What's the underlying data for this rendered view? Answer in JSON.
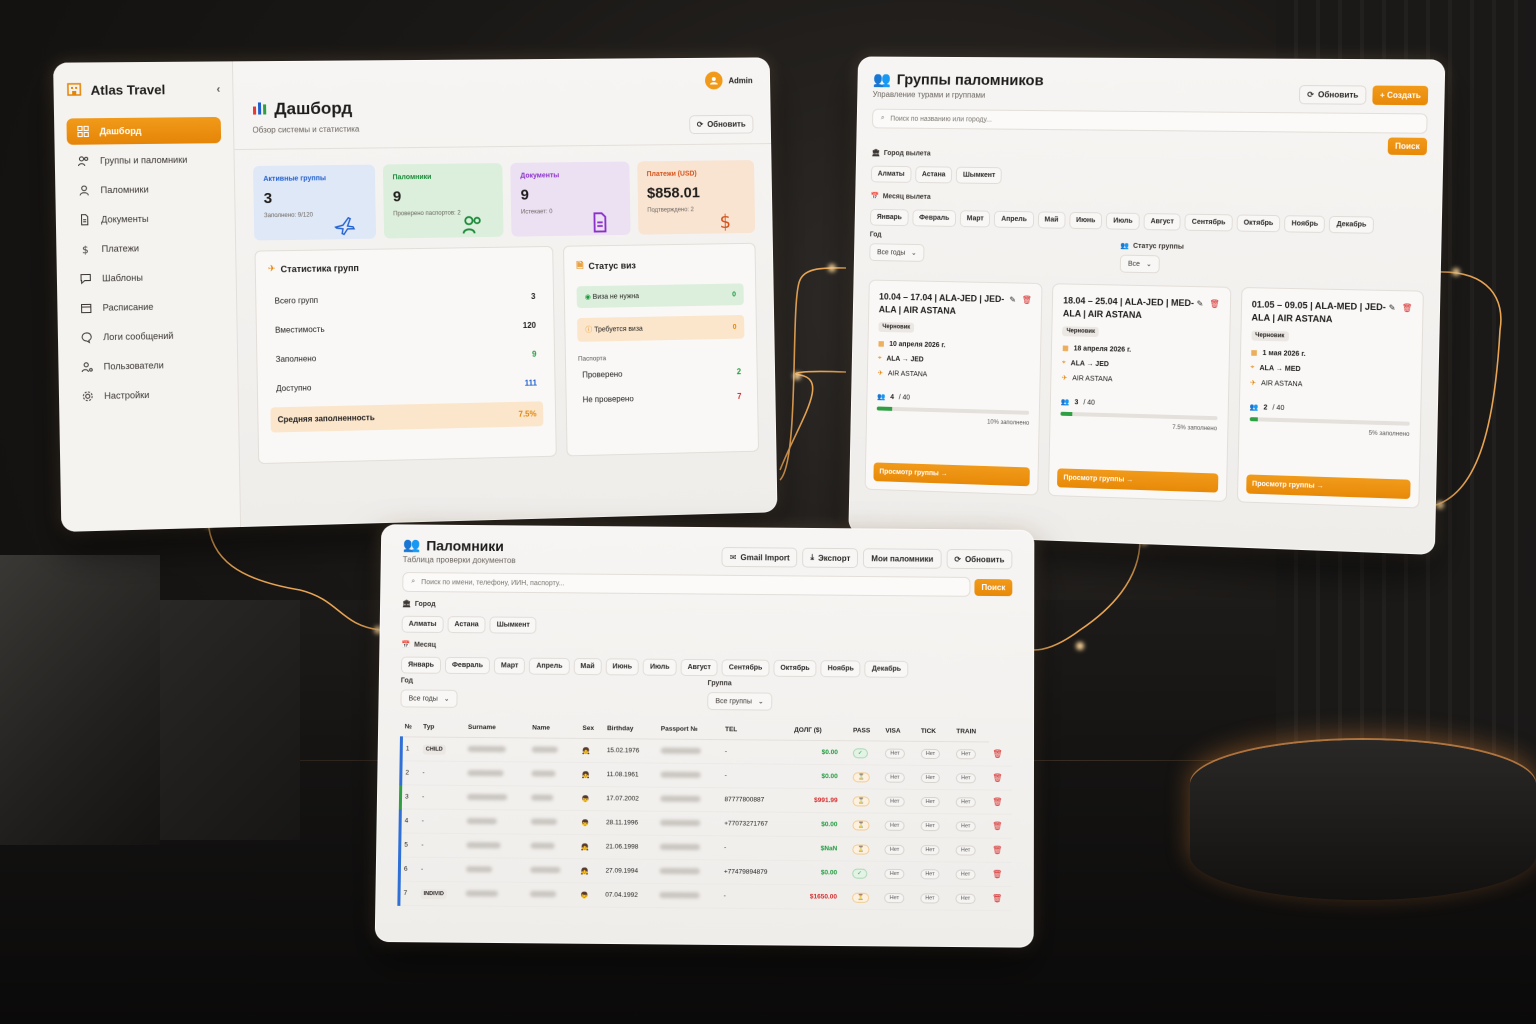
{
  "dashboard": {
    "brand": "Atlas Travel",
    "admin": "Admin",
    "title": "Дашборд",
    "subtitle": "Обзор системы и статистика",
    "refresh": "Обновить",
    "nav": [
      {
        "label": "Дашборд",
        "icon": "grid-icon"
      },
      {
        "label": "Группы и паломники",
        "icon": "users-icon"
      },
      {
        "label": "Паломники",
        "icon": "user-icon"
      },
      {
        "label": "Документы",
        "icon": "document-icon"
      },
      {
        "label": "Платежи",
        "icon": "dollar-icon"
      },
      {
        "label": "Шаблоны",
        "icon": "message-square-icon"
      },
      {
        "label": "Расписание",
        "icon": "calendar-icon"
      },
      {
        "label": "Логи сообщений",
        "icon": "chat-icon"
      },
      {
        "label": "Пользователи",
        "icon": "user-gear-icon"
      },
      {
        "label": "Настройки",
        "icon": "gear-icon"
      }
    ],
    "stats": [
      {
        "title": "Активные группы",
        "value": "3",
        "sub": "Заполнено: 9/120",
        "color": "#1f5fd0",
        "bg": "#dfe8f6",
        "icon": "plane-icon"
      },
      {
        "title": "Паломники",
        "value": "9",
        "sub": "Проверено паспортов: 2",
        "color": "#1b8a3a",
        "bg": "#dcefdc",
        "icon": "users-icon"
      },
      {
        "title": "Документы",
        "value": "9",
        "sub": "Истекает: 0",
        "color": "#8a2fc9",
        "bg": "#ece0f3",
        "icon": "document-icon"
      },
      {
        "title": "Платежи (USD)",
        "value": "$858.01",
        "sub": "Подтверждено: 2",
        "color": "#d4521a",
        "bg": "#f9e4d2",
        "icon": "dollar-icon"
      }
    ],
    "group_stats": {
      "title": "Статистика групп",
      "rows": [
        {
          "label": "Всего групп",
          "value": "3",
          "color": "#1f1d1b"
        },
        {
          "label": "Вместимость",
          "value": "120",
          "color": "#1f1d1b"
        },
        {
          "label": "Заполнено",
          "value": "9",
          "color": "#1b9a3b"
        },
        {
          "label": "Доступно",
          "value": "111",
          "color": "#1f5fd0"
        }
      ],
      "avg_label": "Средняя заполненность",
      "avg_value": "7.5%"
    },
    "visa": {
      "title": "Статус виз",
      "not_needed": "Виза не нужна",
      "not_needed_val": "0",
      "needed": "Требуется виза",
      "needed_val": "0",
      "passports": "Паспорта",
      "checked": "Проверено",
      "checked_val": "2",
      "unchecked": "Не проверено",
      "unchecked_val": "7"
    }
  },
  "groups": {
    "title": "Группы паломников",
    "subtitle": "Управление турами и группами",
    "refresh": "Обновить",
    "create": "+ Создать",
    "search_placeholder": "Поиск по названию или городу...",
    "search_btn": "Поиск",
    "city_label": "Город вылета",
    "cities": [
      "Алматы",
      "Астана",
      "Шымкент"
    ],
    "month_label": "Месяц вылета",
    "months": [
      "Январь",
      "Февраль",
      "Март",
      "Апрель",
      "Май",
      "Июнь",
      "Июль",
      "Август",
      "Сентябрь",
      "Октябрь",
      "Ноябрь",
      "Декабрь"
    ],
    "year_label": "Год",
    "year_value": "Все годы",
    "status_label": "Статус группы",
    "status_value": "Все",
    "cards": [
      {
        "title": "10.04 – 17.04 | ALA-JED | JED-ALA | AIR ASTANA",
        "badge": "Черновик",
        "date": "10 апреля 2026 г.",
        "route": "ALA → JED",
        "airline": "AIR ASTANA",
        "count": "4",
        "cap": "/ 40",
        "fill": 0.1,
        "fill_txt": "10% заполнено",
        "btn": "Просмотр группы →"
      },
      {
        "title": "18.04 – 25.04 | ALA-JED | MED-ALA | AIR ASTANA",
        "badge": "Черновик",
        "date": "18 апреля 2026 г.",
        "route": "ALA → JED",
        "airline": "AIR ASTANA",
        "count": "3",
        "cap": "/ 40",
        "fill": 0.075,
        "fill_txt": "7.5% заполнено",
        "btn": "Просмотр группы →"
      },
      {
        "title": "01.05 – 09.05 | ALA-MED | JED-ALA | AIR ASTANA",
        "badge": "Черновик",
        "date": "1 мая 2026 г.",
        "route": "ALA → MED",
        "airline": "AIR ASTANA",
        "count": "2",
        "cap": "/ 40",
        "fill": 0.05,
        "fill_txt": "5% заполнено",
        "btn": "Просмотр группы →"
      }
    ]
  },
  "pilgrims": {
    "title": "Паломники",
    "subtitle": "Таблица проверки документов",
    "gmail": "Gmail Import",
    "export": "Экспорт",
    "mine": "Мои паломники",
    "refresh": "Обновить",
    "search_placeholder": "Поиск по имени, телефону, ИИН, паспорту...",
    "search_btn": "Поиск",
    "city_label": "Город",
    "cities": [
      "Алматы",
      "Астана",
      "Шымкент"
    ],
    "month_label": "Месяц",
    "months": [
      "Январь",
      "Февраль",
      "Март",
      "Апрель",
      "Май",
      "Июнь",
      "Июль",
      "Август",
      "Сентябрь",
      "Октябрь",
      "Ноябрь",
      "Декабрь"
    ],
    "year_label": "Год",
    "year_value": "Все годы",
    "group_label": "Группа",
    "group_value": "Все группы",
    "columns": [
      "№",
      "Тур",
      "Surname",
      "Name",
      "Sex",
      "Birthday",
      "Passport №",
      "TEL",
      "ДОЛГ ($)",
      "PASS",
      "VISA",
      "TICK",
      "TRAIN"
    ],
    "rows": [
      {
        "n": "1",
        "type": "CHILD",
        "sex": "👧",
        "birthday": "15.02.1976",
        "tel": "-",
        "debt": "$0.00",
        "debt_color": "green",
        "pass": "✓",
        "visa": "Нет",
        "tick": "Нет",
        "train": "Нет",
        "bar": "#2f6fd6"
      },
      {
        "n": "2",
        "type": "-",
        "sex": "👧",
        "birthday": "11.08.1961",
        "tel": "-",
        "debt": "$0.00",
        "debt_color": "green",
        "pass": "⏳",
        "visa": "Нет",
        "tick": "Нет",
        "train": "Нет",
        "bar": "#2f6fd6"
      },
      {
        "n": "3",
        "type": "-",
        "sex": "👦",
        "birthday": "17.07.2002",
        "tel": "87777800887",
        "debt": "$991.99",
        "debt_color": "red",
        "pass": "⏳",
        "visa": "Нет",
        "tick": "Нет",
        "train": "Нет",
        "bar": "#2ea043"
      },
      {
        "n": "4",
        "type": "-",
        "sex": "👦",
        "birthday": "28.11.1996",
        "tel": "+77073271767",
        "debt": "$0.00",
        "debt_color": "green",
        "pass": "⏳",
        "visa": "Нет",
        "tick": "Нет",
        "train": "Нет",
        "bar": "#2f6fd6"
      },
      {
        "n": "5",
        "type": "-",
        "sex": "👧",
        "birthday": "21.06.1998",
        "tel": "-",
        "debt": "$NaN",
        "debt_color": "green",
        "pass": "⏳",
        "visa": "Нет",
        "tick": "Нет",
        "train": "Нет",
        "bar": "#2f6fd6"
      },
      {
        "n": "6",
        "type": "-",
        "sex": "👧",
        "birthday": "27.09.1994",
        "tel": "+77479894879",
        "debt": "$0.00",
        "debt_color": "green",
        "pass": "✓",
        "visa": "Нет",
        "tick": "Нет",
        "train": "Нет",
        "bar": "#2f6fd6"
      },
      {
        "n": "7",
        "type": "INDIVID",
        "sex": "👦",
        "birthday": "07.04.1992",
        "tel": "-",
        "debt": "$1650.00",
        "debt_color": "red",
        "pass": "⏳",
        "visa": "Нет",
        "tick": "Нет",
        "train": "Нет",
        "bar": "#2f6fd6"
      }
    ]
  }
}
